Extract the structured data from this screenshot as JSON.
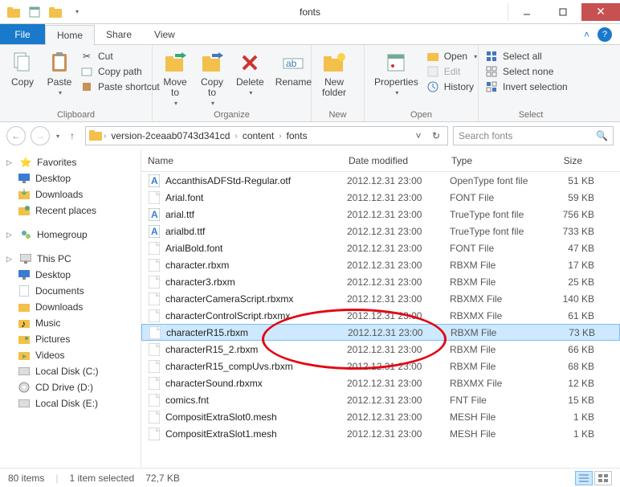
{
  "window": {
    "title": "fonts"
  },
  "tabs": {
    "file": "File",
    "home": "Home",
    "share": "Share",
    "view": "View"
  },
  "ribbon": {
    "clipboard": {
      "label": "Clipboard",
      "copy": "Copy",
      "paste": "Paste",
      "cut": "Cut",
      "copy_path": "Copy path",
      "paste_shortcut": "Paste shortcut"
    },
    "organize": {
      "label": "Organize",
      "move_to": "Move\nto",
      "copy_to": "Copy\nto",
      "delete": "Delete",
      "rename": "Rename"
    },
    "new": {
      "label": "New",
      "new_folder": "New\nfolder"
    },
    "open": {
      "label": "Open",
      "properties": "Properties",
      "open": "Open",
      "edit": "Edit",
      "history": "History"
    },
    "select": {
      "label": "Select",
      "select_all": "Select all",
      "select_none": "Select none",
      "invert": "Invert selection"
    }
  },
  "breadcrumb": {
    "items": [
      "version-2ceaab0743d341cd",
      "content",
      "fonts"
    ]
  },
  "search": {
    "placeholder": "Search fonts"
  },
  "sidebar": {
    "favorites": "Favorites",
    "fav_items": [
      "Desktop",
      "Downloads",
      "Recent places"
    ],
    "homegroup": "Homegroup",
    "thispc": "This PC",
    "pc_items": [
      "Desktop",
      "Documents",
      "Downloads",
      "Music",
      "Pictures",
      "Videos",
      "Local Disk (C:)",
      "CD Drive (D:)",
      "Local Disk (E:)"
    ]
  },
  "columns": {
    "name": "Name",
    "date": "Date modified",
    "type": "Type",
    "size": "Size"
  },
  "files": [
    {
      "icon": "font",
      "name": "AccanthisADFStd-Regular.otf",
      "date": "2012.12.31 23:00",
      "type": "OpenType font file",
      "size": "51 KB"
    },
    {
      "icon": "doc",
      "name": "Arial.font",
      "date": "2012.12.31 23:00",
      "type": "FONT File",
      "size": "59 KB"
    },
    {
      "icon": "font",
      "name": "arial.ttf",
      "date": "2012.12.31 23:00",
      "type": "TrueType font file",
      "size": "756 KB"
    },
    {
      "icon": "font",
      "name": "arialbd.ttf",
      "date": "2012.12.31 23:00",
      "type": "TrueType font file",
      "size": "733 KB"
    },
    {
      "icon": "doc",
      "name": "ArialBold.font",
      "date": "2012.12.31 23:00",
      "type": "FONT File",
      "size": "47 KB"
    },
    {
      "icon": "doc",
      "name": "character.rbxm",
      "date": "2012.12.31 23:00",
      "type": "RBXM File",
      "size": "17 KB"
    },
    {
      "icon": "doc",
      "name": "character3.rbxm",
      "date": "2012.12.31 23:00",
      "type": "RBXM File",
      "size": "25 KB"
    },
    {
      "icon": "doc",
      "name": "characterCameraScript.rbxmx",
      "date": "2012.12.31 23:00",
      "type": "RBXMX File",
      "size": "140 KB"
    },
    {
      "icon": "doc",
      "name": "characterControlScript.rbxmx",
      "date": "2012.12.31 23:00",
      "type": "RBXMX File",
      "size": "61 KB"
    },
    {
      "icon": "doc",
      "name": "characterR15.rbxm",
      "date": "2012.12.31 23:00",
      "type": "RBXM File",
      "size": "73 KB",
      "selected": true
    },
    {
      "icon": "doc",
      "name": "characterR15_2.rbxm",
      "date": "2012.12.31 23:00",
      "type": "RBXM File",
      "size": "66 KB"
    },
    {
      "icon": "doc",
      "name": "characterR15_compUvs.rbxm",
      "date": "2012.12.31 23:00",
      "type": "RBXM File",
      "size": "68 KB"
    },
    {
      "icon": "doc",
      "name": "characterSound.rbxmx",
      "date": "2012.12.31 23:00",
      "type": "RBXMX File",
      "size": "12 KB"
    },
    {
      "icon": "doc",
      "name": "comics.fnt",
      "date": "2012.12.31 23:00",
      "type": "FNT File",
      "size": "15 KB"
    },
    {
      "icon": "doc",
      "name": "CompositExtraSlot0.mesh",
      "date": "2012.12.31 23:00",
      "type": "MESH File",
      "size": "1 KB"
    },
    {
      "icon": "doc",
      "name": "CompositExtraSlot1.mesh",
      "date": "2012.12.31 23:00",
      "type": "MESH File",
      "size": "1 KB"
    }
  ],
  "status": {
    "count": "80 items",
    "selection": "1 item selected",
    "size": "72,7 KB"
  }
}
